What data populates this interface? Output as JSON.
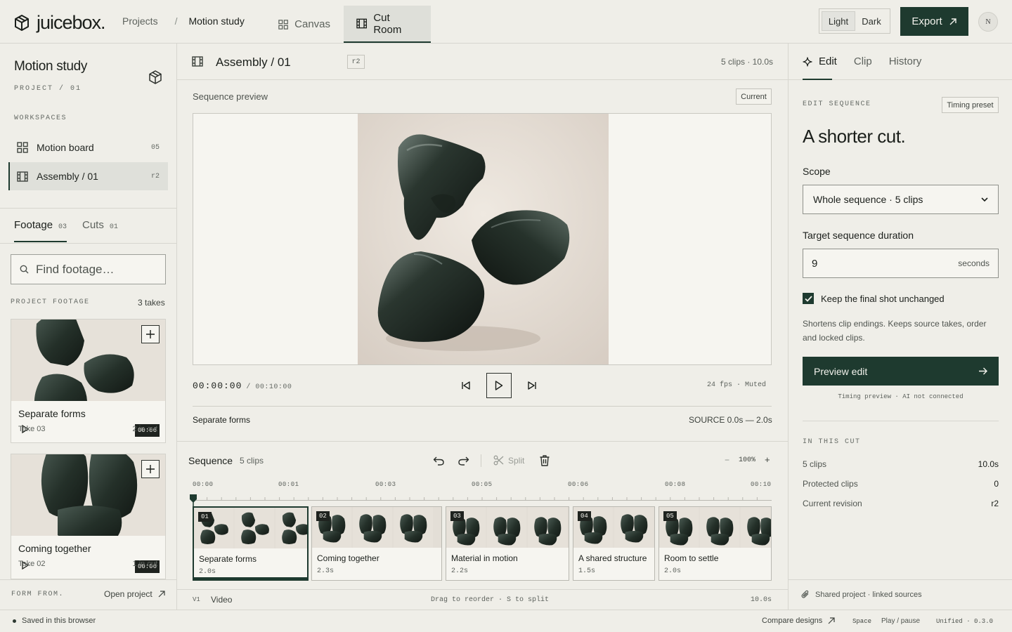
{
  "app": {
    "brand": "juicebox.",
    "accent": "#1e3a2f"
  },
  "breadcrumb": {
    "projects": "Projects",
    "separator": "/",
    "current": "Motion study"
  },
  "top_tabs": [
    {
      "label": "Canvas",
      "icon": "grid-icon"
    },
    {
      "label": "Cut Room",
      "icon": "film-icon",
      "active": true
    }
  ],
  "theme": {
    "light": "Light",
    "dark": "Dark",
    "selected": "Light"
  },
  "export_label": "Export",
  "avatar_initial": "N",
  "sidebar": {
    "project_title": "Motion study",
    "project_sub": "PROJECT / 01",
    "workspaces_label": "WORKSPACES",
    "workspaces": [
      {
        "label": "Motion board",
        "count": "05",
        "icon": "grid-icon"
      },
      {
        "label": "Assembly / 01",
        "count": "r2",
        "icon": "film-icon",
        "active": true
      }
    ],
    "tabs": [
      {
        "label": "Footage",
        "count": "03",
        "active": true
      },
      {
        "label": "Cuts",
        "count": "01"
      }
    ],
    "search_placeholder": "Find footage…",
    "project_footage_label": "PROJECT FOOTAGE",
    "takes_count": "3 takes",
    "footage": [
      {
        "title": "Separate forms",
        "take": "Take 03",
        "in_cut": "2 in cut",
        "duration": "00:06"
      },
      {
        "title": "Coming together",
        "take": "Take 02",
        "in_cut": "1 in cut",
        "duration": "00:06"
      }
    ],
    "footer_label": "FORM FROM.",
    "open_project": "Open project"
  },
  "sequence": {
    "name": "Assembly / 01",
    "revision": "r2",
    "meta": "5 clips · 10.0s",
    "preview_label": "Sequence preview",
    "current_badge": "Current",
    "timecode": "00:00:00",
    "total": "/ 00:10:00",
    "fps": "24 fps · Muted",
    "clip_name": "Separate forms",
    "source": "SOURCE 0.0s — 2.0s"
  },
  "timeline": {
    "title": "Sequence",
    "count": "5 clips",
    "split_label": "Split",
    "zoom_minus": "−",
    "zoom": "100%",
    "zoom_plus": "+",
    "ticks": [
      "00:00",
      "00:01",
      "00:03",
      "00:05",
      "00:06",
      "00:08",
      "00:10"
    ],
    "clips": [
      {
        "num": "01",
        "name": "Separate forms",
        "duration": "2.0s",
        "selected": true
      },
      {
        "num": "02",
        "name": "Coming together",
        "duration": "2.3s"
      },
      {
        "num": "03",
        "name": "Material in motion",
        "duration": "2.2s"
      },
      {
        "num": "04",
        "name": "A shared structure",
        "duration": "1.5s"
      },
      {
        "num": "05",
        "name": "Room to settle",
        "duration": "2.0s"
      }
    ],
    "track": "V1",
    "track_name": "Video",
    "hint": "Drag to reorder · S to split",
    "total": "10.0s"
  },
  "panel": {
    "tabs": [
      "Edit",
      "Clip",
      "History"
    ],
    "active_tab": "Edit",
    "edit_label": "EDIT SEQUENCE",
    "preset": "Timing preset",
    "headline": "A shorter cut.",
    "scope_label": "Scope",
    "scope_value": "Whole sequence · 5 clips",
    "duration_label": "Target sequence duration",
    "duration_value": "9",
    "duration_unit": "seconds",
    "keep_label": "Keep the final shot unchanged",
    "keep_checked": true,
    "explain": "Shortens clip endings. Keeps source takes, order and locked clips.",
    "preview_btn": "Preview edit",
    "note": "Timing preview · AI not connected",
    "in_cut_label": "IN THIS CUT",
    "stats": [
      {
        "k": "5 clips",
        "v": "10.0s"
      },
      {
        "k": "Protected clips",
        "v": "0"
      },
      {
        "k": "Current revision",
        "v": "r2"
      }
    ],
    "shared": "Shared project · linked sources"
  },
  "status": {
    "saved": "Saved in this browser",
    "compare": "Compare designs",
    "key": "Space",
    "key_action": "Play / pause",
    "version": "Unified · 0.3.0"
  }
}
